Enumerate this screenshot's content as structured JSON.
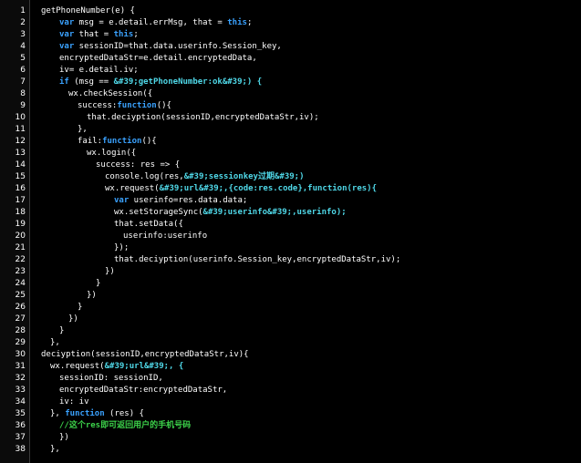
{
  "lines": [
    {
      "n": "1",
      "indent": 0,
      "parts": [
        [
          "pl",
          "getPhoneNumber(e) {"
        ]
      ]
    },
    {
      "n": "2",
      "indent": 2,
      "parts": [
        [
          "kw",
          "var"
        ],
        [
          "pl",
          " msg = e.detail.errMsg, that = "
        ],
        [
          "kw",
          "this"
        ],
        [
          "pl",
          ";"
        ]
      ]
    },
    {
      "n": "3",
      "indent": 2,
      "parts": [
        [
          "kw",
          "var"
        ],
        [
          "pl",
          " that = "
        ],
        [
          "kw",
          "this"
        ],
        [
          "pl",
          ";"
        ]
      ]
    },
    {
      "n": "4",
      "indent": 2,
      "parts": [
        [
          "kw",
          "var"
        ],
        [
          "pl",
          " sessionID=that.data.userinfo.Session_key,"
        ]
      ]
    },
    {
      "n": "5",
      "indent": 2,
      "parts": [
        [
          "pl",
          "encryptedDataStr=e.detail.encryptedData,"
        ]
      ]
    },
    {
      "n": "6",
      "indent": 2,
      "parts": [
        [
          "pl",
          "iv= e.detail.iv;"
        ]
      ]
    },
    {
      "n": "7",
      "indent": 2,
      "parts": [
        [
          "kw",
          "if"
        ],
        [
          "pl",
          " (msg == "
        ],
        [
          "str",
          "&#39;getPhoneNumber:ok&#39;) {"
        ]
      ]
    },
    {
      "n": "8",
      "indent": 3,
      "parts": [
        [
          "pl",
          "wx.checkSession({"
        ]
      ]
    },
    {
      "n": "9",
      "indent": 4,
      "parts": [
        [
          "pl",
          "success:"
        ],
        [
          "fn",
          "function"
        ],
        [
          "pl",
          "(){"
        ]
      ]
    },
    {
      "n": "10",
      "indent": 5,
      "parts": [
        [
          "pl",
          "that.deciyption(sessionID,encryptedDataStr,iv);"
        ]
      ]
    },
    {
      "n": "11",
      "indent": 4,
      "parts": [
        [
          "pl",
          "},"
        ]
      ]
    },
    {
      "n": "12",
      "indent": 4,
      "parts": [
        [
          "pl",
          "fail:"
        ],
        [
          "fn",
          "function"
        ],
        [
          "pl",
          "(){"
        ]
      ]
    },
    {
      "n": "13",
      "indent": 5,
      "parts": [
        [
          "pl",
          "wx.login({"
        ]
      ]
    },
    {
      "n": "14",
      "indent": 6,
      "parts": [
        [
          "pl",
          "success: res => {"
        ]
      ]
    },
    {
      "n": "15",
      "indent": 7,
      "parts": [
        [
          "pl",
          "console.log(res,"
        ],
        [
          "str",
          "&#39;sessionkey过期&#39;)"
        ]
      ]
    },
    {
      "n": "16",
      "indent": 7,
      "parts": [
        [
          "pl",
          "wx.request("
        ],
        [
          "str",
          "&#39;url&#39;,{code:res.code},function(res){"
        ]
      ]
    },
    {
      "n": "17",
      "indent": 8,
      "parts": [
        [
          "kw",
          "var"
        ],
        [
          "pl",
          " userinfo=res.data.data;"
        ]
      ]
    },
    {
      "n": "18",
      "indent": 8,
      "parts": [
        [
          "pl",
          "wx.setStorageSync("
        ],
        [
          "str",
          "&#39;userinfo&#39;,userinfo);"
        ]
      ]
    },
    {
      "n": "19",
      "indent": 8,
      "parts": [
        [
          "pl",
          "that.setData({"
        ]
      ]
    },
    {
      "n": "20",
      "indent": 9,
      "parts": [
        [
          "pl",
          "userinfo:userinfo"
        ]
      ]
    },
    {
      "n": "21",
      "indent": 8,
      "parts": [
        [
          "pl",
          "});"
        ]
      ]
    },
    {
      "n": "22",
      "indent": 8,
      "parts": [
        [
          "pl",
          "that.deciyption(userinfo.Session_key,encryptedDataStr,iv);"
        ]
      ]
    },
    {
      "n": "23",
      "indent": 7,
      "parts": [
        [
          "pl",
          "})"
        ]
      ]
    },
    {
      "n": "24",
      "indent": 6,
      "parts": [
        [
          "pl",
          "}"
        ]
      ]
    },
    {
      "n": "25",
      "indent": 5,
      "parts": [
        [
          "pl",
          "})"
        ]
      ]
    },
    {
      "n": "26",
      "indent": 4,
      "parts": [
        [
          "pl",
          "}"
        ]
      ]
    },
    {
      "n": "27",
      "indent": 3,
      "parts": [
        [
          "pl",
          "})"
        ]
      ]
    },
    {
      "n": "28",
      "indent": 2,
      "parts": [
        [
          "pl",
          "}"
        ]
      ]
    },
    {
      "n": "29",
      "indent": 1,
      "parts": [
        [
          "pl",
          "},"
        ]
      ]
    },
    {
      "n": "30",
      "indent": 0,
      "parts": [
        [
          "pl",
          "deciyption(sessionID,encryptedDataStr,iv){"
        ]
      ]
    },
    {
      "n": "31",
      "indent": 1,
      "parts": [
        [
          "pl",
          "wx.request("
        ],
        [
          "str",
          "&#39;url&#39;, {"
        ]
      ]
    },
    {
      "n": "32",
      "indent": 2,
      "parts": [
        [
          "pl",
          "sessionID: sessionID,"
        ]
      ]
    },
    {
      "n": "33",
      "indent": 2,
      "parts": [
        [
          "pl",
          "encryptedDataStr:encryptedDataStr,"
        ]
      ]
    },
    {
      "n": "34",
      "indent": 2,
      "parts": [
        [
          "pl",
          "iv: iv"
        ]
      ]
    },
    {
      "n": "35",
      "indent": 1,
      "parts": [
        [
          "pl",
          "}, "
        ],
        [
          "fn",
          "function"
        ],
        [
          "pl",
          " (res) {"
        ]
      ]
    },
    {
      "n": "36",
      "indent": 2,
      "parts": [
        [
          "cm",
          "//这个res即可返回用户的手机号码"
        ]
      ]
    },
    {
      "n": "37",
      "indent": 2,
      "parts": [
        [
          "pl",
          "})"
        ]
      ]
    },
    {
      "n": "38",
      "indent": 1,
      "parts": [
        [
          "pl",
          "},"
        ]
      ]
    }
  ]
}
